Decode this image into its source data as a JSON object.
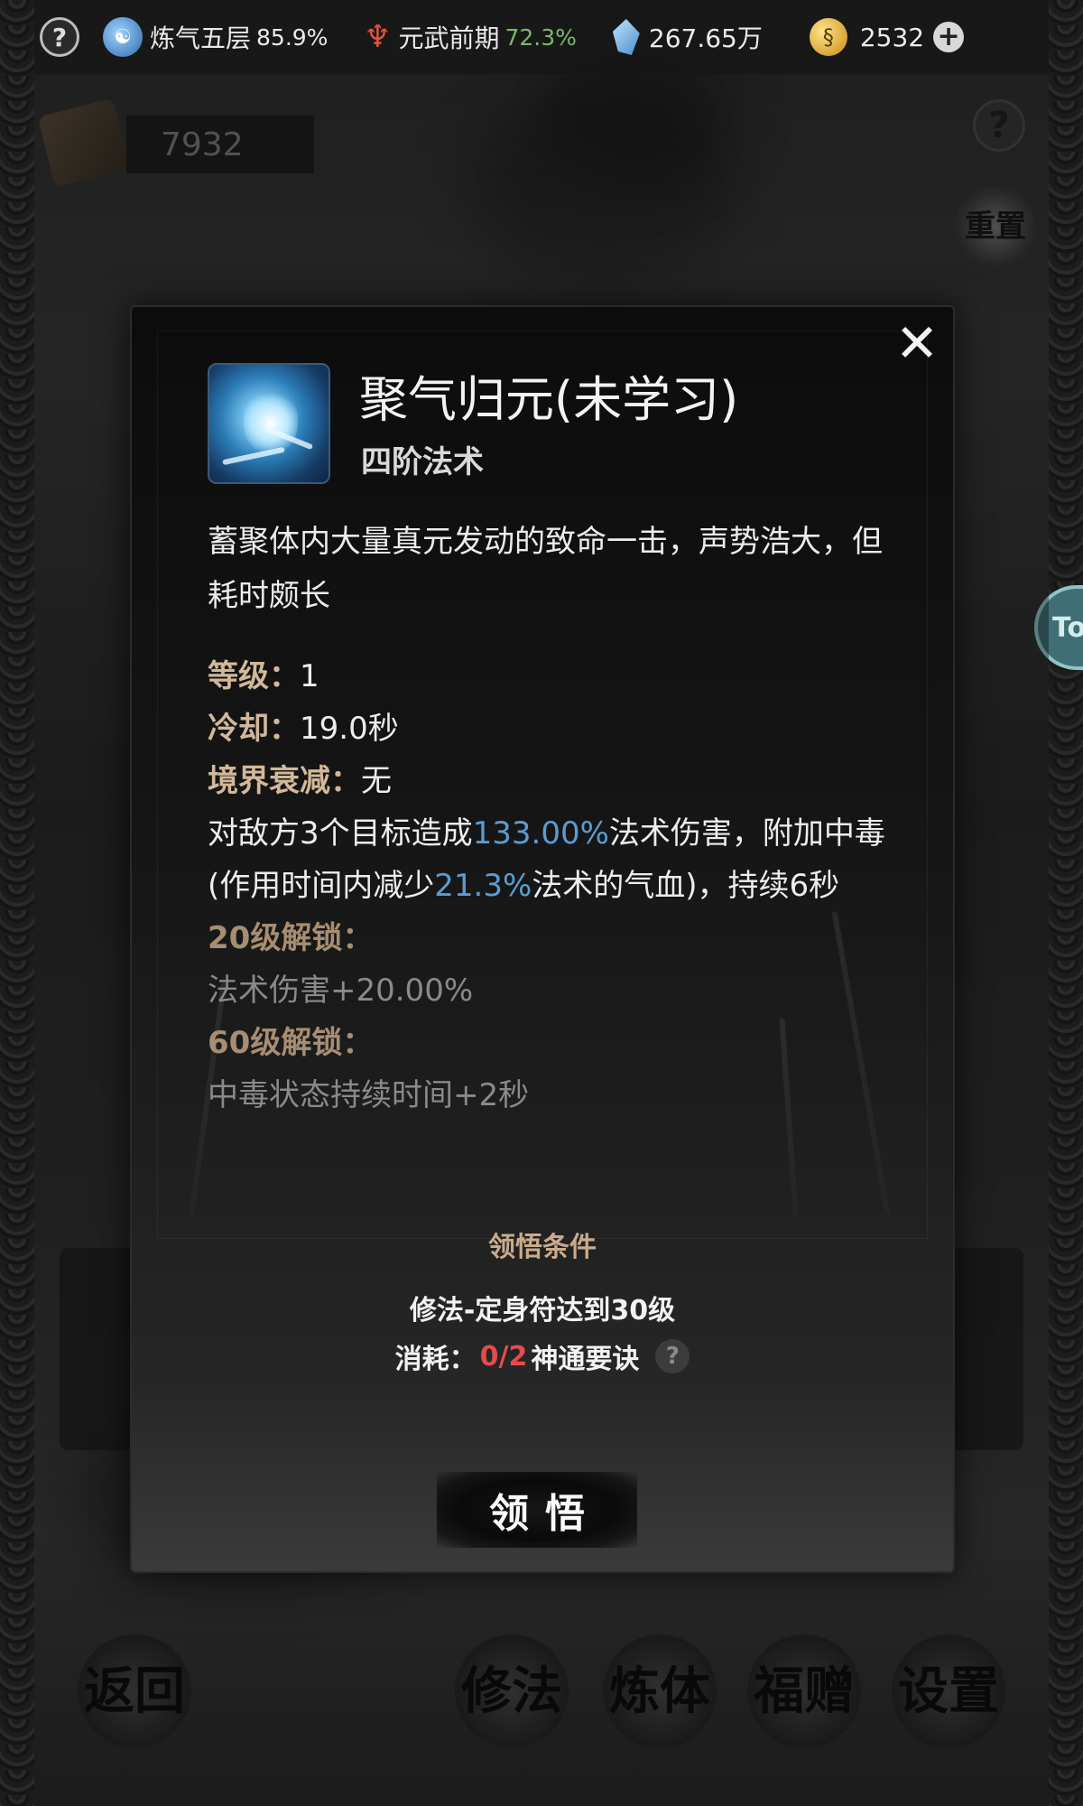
{
  "topbar": {
    "help_icon": "question-icon",
    "realm_label": "炼气五层",
    "realm_pct": "85.9%",
    "weapon_label": "元武前期",
    "weapon_pct": "72.3%",
    "spirit_stones": "267.65万",
    "gold": "2532",
    "accent_green": "#7bb86b"
  },
  "page": {
    "points": "7932",
    "reset_label": "重置",
    "side_tab": "To"
  },
  "modal": {
    "title": "聚气归元(未学习)",
    "rank": "四阶法术",
    "description": "蓄聚体内大量真元发动的致命一击，声势浩大，但耗时颇长",
    "level_label": "等级：",
    "level_value": "1",
    "cooldown_label": "冷却：",
    "cooldown_value": "19.0秒",
    "decay_label": "境界衰减：",
    "decay_value": "无",
    "effect": {
      "p1": "对敌方3个目标造成",
      "v1": "133.00%",
      "p2": "法术伤害，附加中毒(作用时间内减少",
      "v2": "21.3%",
      "p3": "法术的气血)，持续6秒"
    },
    "unlock20_label": "20级解锁：",
    "unlock20_value": "法术伤害+20.00%",
    "unlock60_label": "60级解锁：",
    "unlock60_value": "中毒状态持续时间+2秒",
    "condition_title": "领悟条件",
    "condition_req": "修法-定身符达到30级",
    "cost_label": "消耗：",
    "cost_value": "0/2",
    "cost_item": "神通要诀",
    "learn_button": "领悟",
    "highlight_color": "#5d9bd1",
    "cost_color": "#e34c4c"
  },
  "nav": {
    "back": "返回",
    "cultivate_magic": "修法",
    "refine_body": "炼体",
    "blessing": "福赠",
    "settings": "设置"
  }
}
